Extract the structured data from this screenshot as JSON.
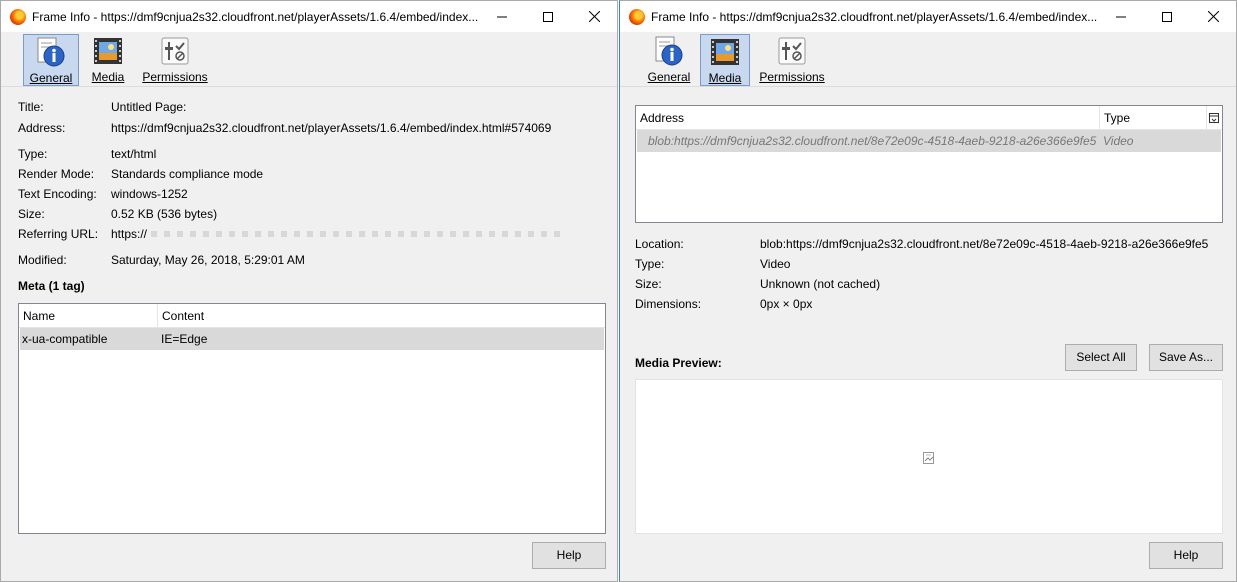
{
  "left_window": {
    "title": "Frame Info - https://dmf9cnjua2s32.cloudfront.net/playerAssets/1.6.4/embed/index...",
    "tabs": [
      "General",
      "Media",
      "Permissions"
    ],
    "active_tab": "General",
    "fields": {
      "title_label": "Title:",
      "title_value": "Untitled Page:",
      "address_label": "Address:",
      "address_value": "https://dmf9cnjua2s32.cloudfront.net/playerAssets/1.6.4/embed/index.html#574069",
      "type_label": "Type:",
      "type_value": "text/html",
      "render_label": "Render Mode:",
      "render_value": "Standards compliance mode",
      "encoding_label": "Text Encoding:",
      "encoding_value": "windows-1252",
      "size_label": "Size:",
      "size_value": "0.52 KB (536 bytes)",
      "referring_label": "Referring URL:",
      "referring_value": "https://",
      "modified_label": "Modified:",
      "modified_value": "Saturday, May 26, 2018, 5:29:01 AM"
    },
    "meta_heading": "Meta (1 tag)",
    "meta_table": {
      "headers": [
        "Name",
        "Content"
      ],
      "rows": [
        [
          "x-ua-compatible",
          "IE=Edge"
        ]
      ]
    },
    "help_button": "Help"
  },
  "right_window": {
    "title": "Frame Info - https://dmf9cnjua2s32.cloudfront.net/playerAssets/1.6.4/embed/index...",
    "tabs": [
      "General",
      "Media",
      "Permissions"
    ],
    "active_tab": "Media",
    "media_table": {
      "headers": [
        "Address",
        "Type"
      ],
      "rows": [
        [
          "blob:https://dmf9cnjua2s32.cloudfront.net/8e72e09c-4518-4aeb-9218-a26e366e9fe5",
          "Video"
        ]
      ]
    },
    "fields": {
      "location_label": "Location:",
      "location_value": "blob:https://dmf9cnjua2s32.cloudfront.net/8e72e09c-4518-4aeb-9218-a26e366e9fe5",
      "type_label": "Type:",
      "type_value": "Video",
      "size_label": "Size:",
      "size_value": "Unknown (not cached)",
      "dimensions_label": "Dimensions:",
      "dimensions_value": "0px × 0px"
    },
    "media_preview_label": "Media Preview:",
    "select_all_button": "Select All",
    "save_as_button": "Save As...",
    "help_button": "Help"
  },
  "colors": {
    "dialog_bg": "#f0f0f0",
    "active_tab_bg": "#c8d8ee",
    "selected_row_bg": "#d9d9d9",
    "button_bg": "#e1e1e1"
  }
}
